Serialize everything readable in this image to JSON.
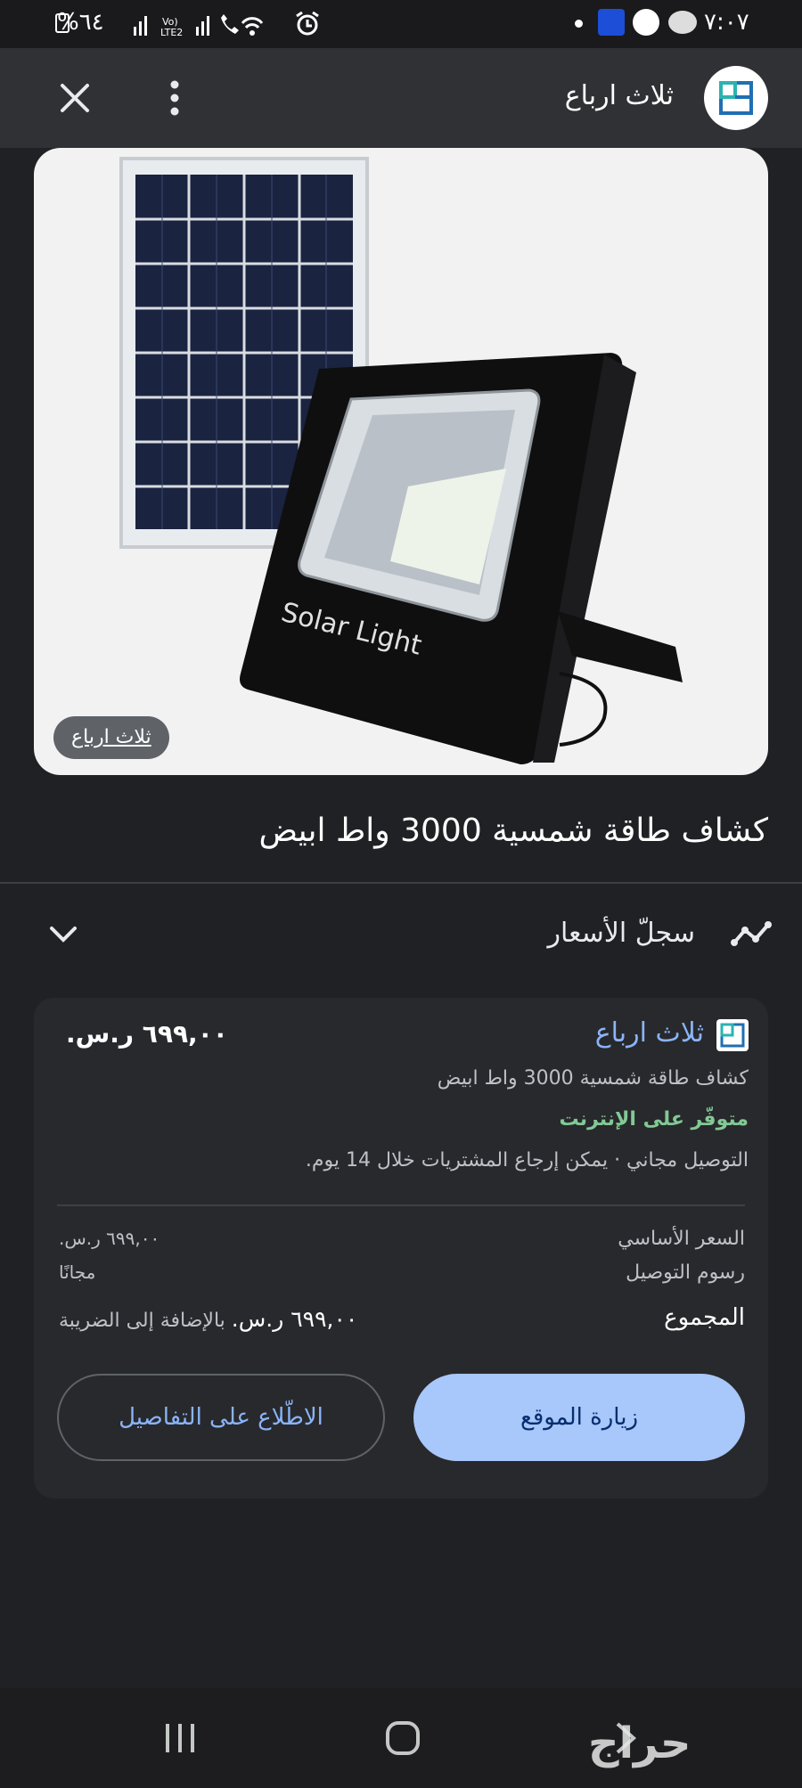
{
  "status_bar": {
    "time": "٧:٠٧",
    "battery": "%٦٤",
    "network": "LTE2"
  },
  "header": {
    "site_name": "ثلاث ارباع"
  },
  "image": {
    "badge_text": "ثلاث ارباع",
    "product_printed_text": "Solar Light"
  },
  "product": {
    "title": "كشاف طاقة شمسية 3000 واط ابيض"
  },
  "price_history": {
    "label": "سجلّ الأسعار"
  },
  "offer": {
    "seller": "ثلاث ارباع",
    "price": "٦٩٩,٠٠ ر.س.",
    "product_name": "كشاف طاقة شمسية 3000 واط ابيض",
    "availability": "متوفّر على الإنترنت",
    "shipping_returns": "التوصيل مجاني · يمكن إرجاع المشتريات خلال 14 يوم.",
    "base_price_label": "السعر الأساسي",
    "base_price_value": "٦٩٩,٠٠ ر.س.",
    "shipping_label": "رسوم التوصيل",
    "shipping_value": "مجانًا",
    "total_label": "المجموع",
    "total_value": "٦٩٩,٠٠ ر.س.",
    "total_suffix": "بالإضافة إلى الضريبة",
    "visit_button": "زيارة الموقع",
    "details_button": "الاطّلاع على التفاصيل"
  },
  "watermark": "حراج",
  "colors": {
    "background": "#202124",
    "accent_blue": "#8ab4f8",
    "button_blue": "#a8c7fa",
    "availability_green": "#81c995"
  }
}
